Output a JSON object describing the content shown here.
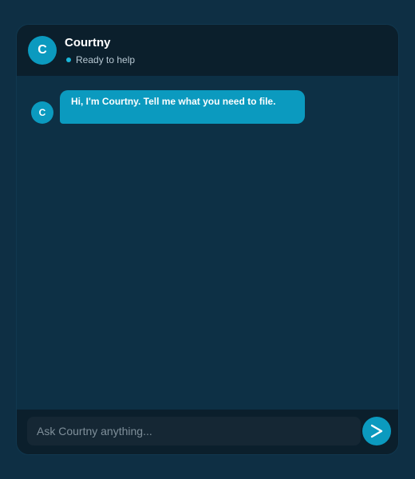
{
  "assistant": {
    "avatar_initial": "C",
    "name": "Courtny",
    "status": "Ready to help"
  },
  "messages": [
    {
      "sender": "assistant",
      "avatar_initial": "C",
      "text": "Hi, I'm Courtny. Tell me what you need to file."
    }
  ],
  "composer": {
    "placeholder": "Ask Courtny anything...",
    "send_icon": "send-arrow-icon"
  },
  "colors": {
    "page_bg": "#0e2f44",
    "panel_bg": "#0d3045",
    "header_bg": "#0b1f2c",
    "accent": "#0b9abf",
    "input_bg": "#152734"
  }
}
